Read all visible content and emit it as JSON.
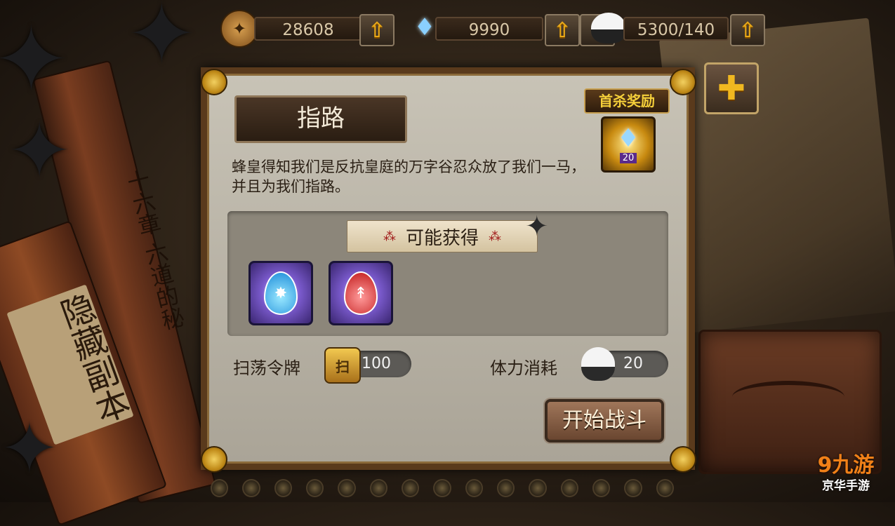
{
  "resources": [
    {
      "icon": "shuriken-coin-icon",
      "value": "28608"
    },
    {
      "icon": "diamond-icon",
      "value": "9990"
    },
    {
      "icon": "rice-ball-icon",
      "value": "5300/140"
    }
  ],
  "background": {
    "scroll_text_vertical": "十六章 六道的秘",
    "scroll_text_paper": "隐藏副本"
  },
  "dialog": {
    "title": "指路",
    "description": "蜂皇得知我们是反抗皇庭的万字谷忍众放了我们一马，并且为我们指路。",
    "possible_rewards_title": "可能获得",
    "first_kill": {
      "label": "首杀奖励",
      "icon": "diamond-icon",
      "count": "20"
    },
    "items": [
      {
        "icon": "blue-water-drop-icon"
      },
      {
        "icon": "red-blood-drop-icon"
      }
    ],
    "sweep_label": "扫荡令牌",
    "sweep_value": "100",
    "stamina_label": "体力消耗",
    "stamina_value": "20",
    "start_button": "开始战斗"
  },
  "watermark": {
    "logo": "9九游",
    "site": "京华手游"
  },
  "colors": {
    "accent": "#e8a818",
    "dialog_bg": "#c8c3b6",
    "frame": "#5a3a1c"
  }
}
